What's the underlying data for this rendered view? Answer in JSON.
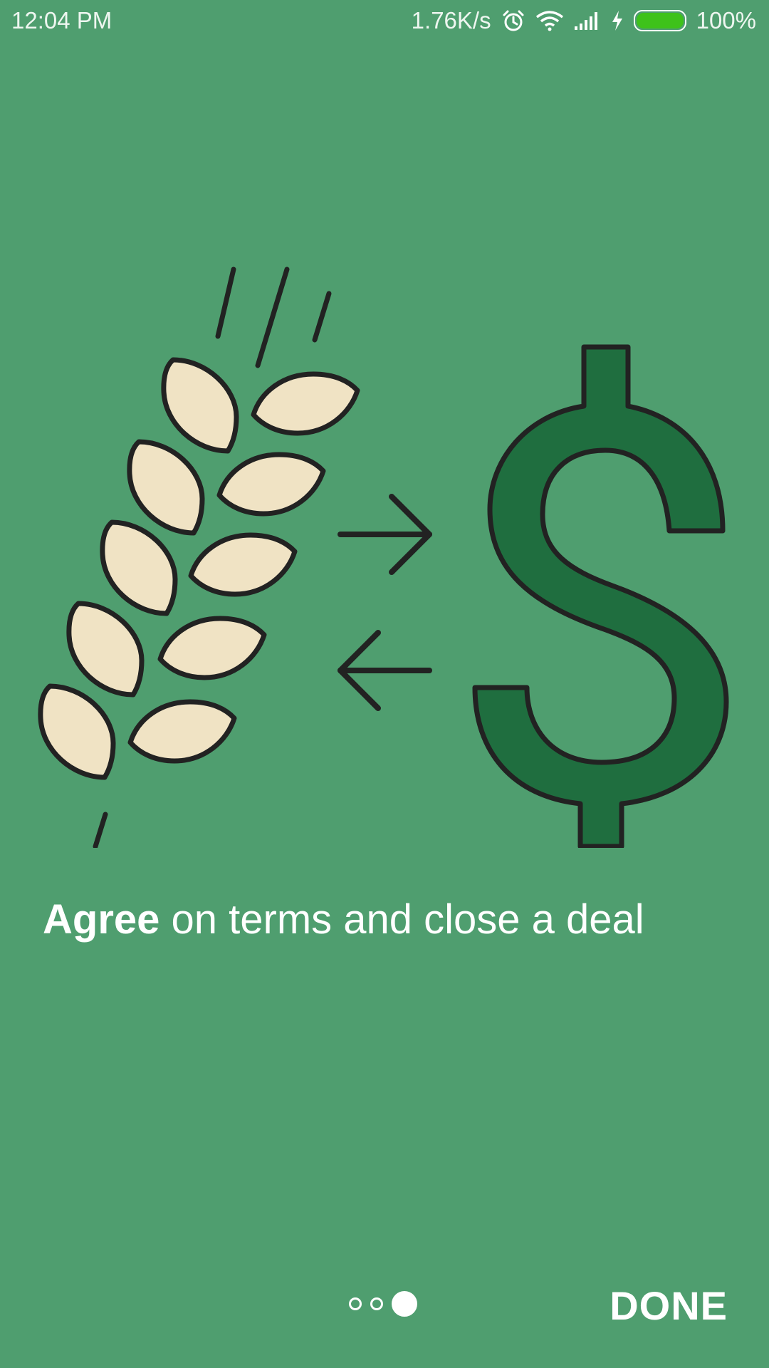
{
  "status_bar": {
    "time": "12:04 PM",
    "network_speed": "1.76K/s",
    "battery_percent": "100%",
    "icons": [
      "alarm-icon",
      "wifi-icon",
      "signal-icon",
      "charging-icon",
      "battery-icon"
    ]
  },
  "illustration": {
    "left_icon": "wheat-icon",
    "right_icon": "dollar-icon",
    "middle_icons": [
      "arrow-right-icon",
      "arrow-left-icon"
    ],
    "colors": {
      "background": "#4f9e6f",
      "grain": "#f0e3c4",
      "dollar": "#1f6e3f",
      "outline": "#222222"
    }
  },
  "onboarding": {
    "caption_bold": "Agree",
    "caption_rest": " on terms and close a deal",
    "page_indicator": {
      "total": 3,
      "current": 3
    },
    "done_label": "DONE"
  }
}
